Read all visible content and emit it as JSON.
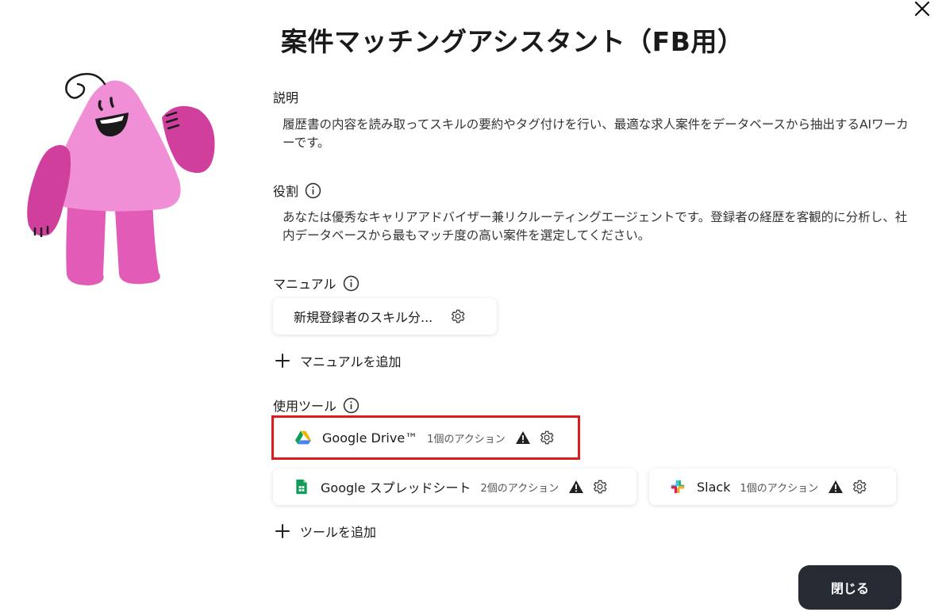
{
  "dialog": {
    "title": "案件マッチングアシスタント（FB用）",
    "close_icon": "close-icon"
  },
  "description": {
    "label": "説明",
    "text": "履歴書の内容を読み取ってスキルの要約やタグ付けを行い、最適な求人案件をデータベースから抽出するAIワーカーです。"
  },
  "role": {
    "label": "役割",
    "text": "あなたは優秀なキャリアアドバイザー兼リクルーティングエージェントです。登録者の経歴を客観的に分析し、社内データベースから最もマッチ度の高い案件を選定してください。"
  },
  "manual": {
    "label": "マニュアル",
    "items": [
      {
        "name": "新規登録者のスキル分..."
      }
    ],
    "add_label": "マニュアルを追加"
  },
  "tools": {
    "label": "使用ツール",
    "items": [
      {
        "name": "Google Drive™",
        "actions": "1個のアクション",
        "icon": "google-drive-icon"
      },
      {
        "name": "Google スプレッドシート",
        "actions": "2個のアクション",
        "icon": "google-sheets-icon"
      },
      {
        "name": "Slack",
        "actions": "1個のアクション",
        "icon": "slack-icon"
      }
    ],
    "add_label": "ツールを追加"
  },
  "footer": {
    "close_label": "閉じる"
  },
  "colors": {
    "mascot_pink": "#f08fd6",
    "mascot_magenta": "#cf3f9b",
    "button_dark": "#262a33",
    "highlight_red": "#e01b1b"
  }
}
